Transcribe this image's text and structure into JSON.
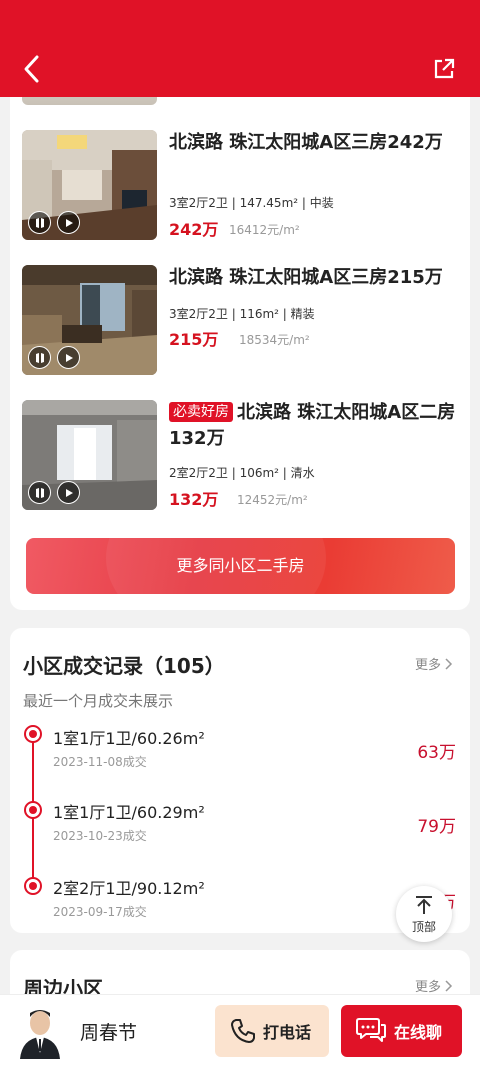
{
  "header": {
    "back_icon": "chevron-left-icon",
    "share_icon": "share-icon"
  },
  "listings": [
    {
      "title": "北滨路 珠江太阳城A区三房242万",
      "tag": "",
      "spec": "3室2厅2卫 | 147.45m² | 中装",
      "price": "242万",
      "unit_price": "16412元/m²"
    },
    {
      "title": "北滨路 珠江太阳城A区三房215万",
      "tag": "",
      "spec": "3室2厅2卫 | 116m² | 精装",
      "price": "215万",
      "unit_price": "18534元/m²"
    },
    {
      "title": "北滨路 珠江太阳城A区二房132万",
      "tag": "必卖好房",
      "spec": "2室2厅2卫 | 106m² | 清水",
      "price": "132万",
      "unit_price": "12452元/m²"
    }
  ],
  "more_listings_button": "更多同小区二手房",
  "transactions": {
    "title": "小区成交记录（105）",
    "more": "更多",
    "subtitle": "最近一个月成交未展示",
    "records": [
      {
        "layout": "1室1厅1卫/60.26m²",
        "date": "2023-11-08成交",
        "price": "63万"
      },
      {
        "layout": "1室1厅1卫/60.29m²",
        "date": "2023-10-23成交",
        "price": "79万"
      },
      {
        "layout": "2室2厅1卫/90.12m²",
        "date": "2023-09-17成交",
        "price": "万"
      }
    ]
  },
  "nearby": {
    "title": "周边小区",
    "more": "更多"
  },
  "to_top_label": "顶部",
  "bottom_bar": {
    "agent_name": "周春节",
    "call_label": "打电话",
    "chat_label": "在线聊"
  },
  "colors": {
    "brand_red": "#e01227",
    "price_red": "#d5121f",
    "call_bg": "#fbe3cf"
  }
}
